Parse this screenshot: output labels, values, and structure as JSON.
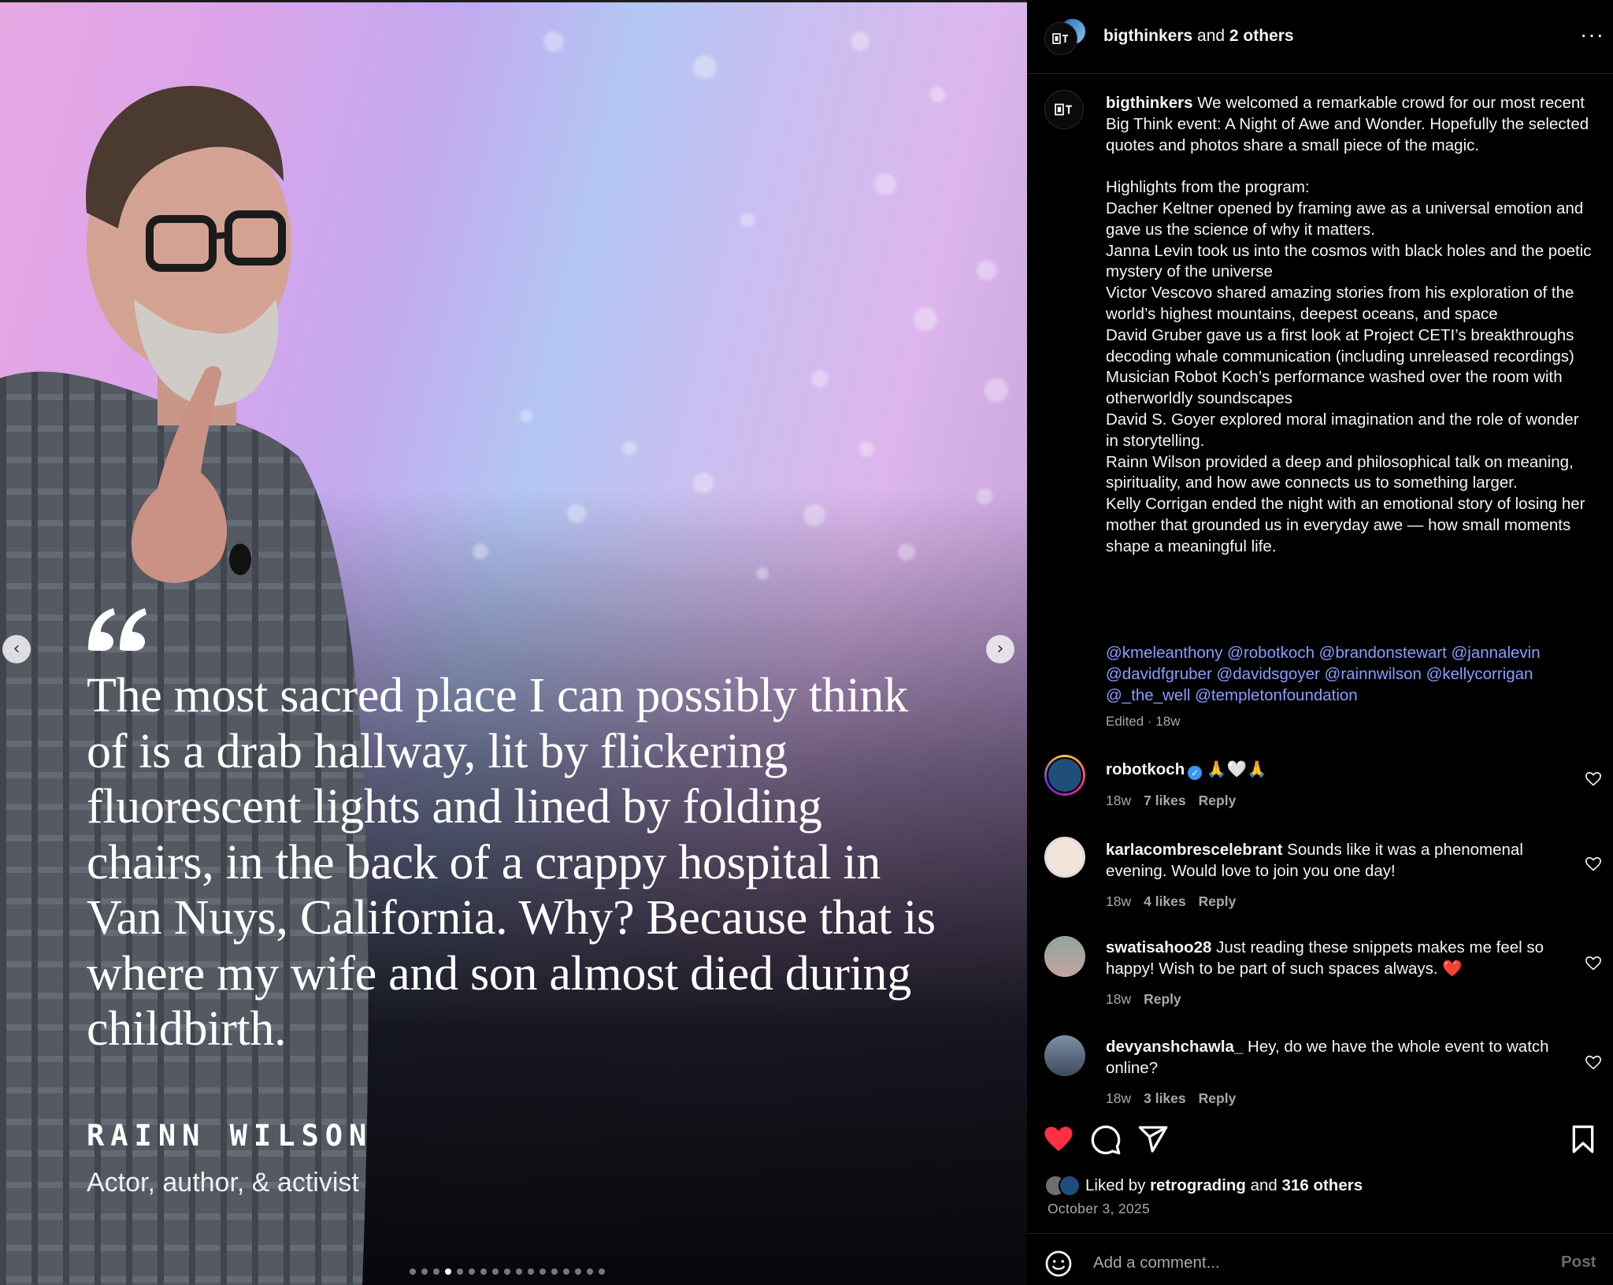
{
  "media": {
    "quote": "The most sacred place I can possibly think of is a drab hallway, lit by flickering fluorescent lights and lined by folding chairs, in the back of a crappy hospital in Van Nuys, California. Why? Because that is where my wife and son almost died during childbirth.",
    "speaker_name": "RAINN WILSON",
    "speaker_title": "Actor, author, & activist",
    "prev_icon": "‹",
    "next_icon": "›",
    "carousel_count": 17,
    "carousel_active_index": 3
  },
  "header": {
    "username": "bigthinkers",
    "and_text": " and ",
    "others": "2 others",
    "more_icon": "···"
  },
  "caption": {
    "username": "bigthinkers",
    "text": " We welcomed a remarkable crowd for our most recent Big Think event: A Night of Awe and Wonder. Hopefully the selected quotes and photos share a small piece of the magic.\n\nHighlights from the program:\nDacher Keltner opened by framing awe as a universal emotion and gave us the science of why it matters.\nJanna Levin took us into the cosmos with black holes and the poetic mystery of the universe\nVictor Vescovo shared amazing stories from his exploration of the world’s highest mountains, deepest oceans, and space\nDavid Gruber gave us a first look at Project CETI’s breakthroughs decoding whale communication (including unreleased recordings)\nMusician Robot Koch’s performance washed over the room with otherworldly soundscapes\nDavid S. Goyer explored moral imagination and the role of wonder in storytelling.\nRainn Wilson provided a deep and philosophical talk on meaning, spirituality, and how awe connects us to something larger.\nKelly Corrigan ended the night with an emotional story of losing her mother that grounded us in everyday awe — how small moments shape a meaningful life.",
    "mentions": "@kmeleanthony @robotkoch @brandonstewart @jannalevin @davidfgruber @davidsgoyer @rainnwilson @kellycorrigan @_the_well @templetonfoundation",
    "edited": "Edited · 18w"
  },
  "comments": [
    {
      "username": "robotkoch",
      "verified": true,
      "text": " 🙏🤍🙏",
      "time": "18w",
      "likes": "7 likes",
      "reply": "Reply"
    },
    {
      "username": "karlacombrescelebrant",
      "verified": false,
      "text": " Sounds like it was a phenomenal evening. Would love to join you one day!",
      "time": "18w",
      "likes": "4 likes",
      "reply": "Reply"
    },
    {
      "username": "swatisahoo28",
      "verified": false,
      "text": " Just reading these snippets makes me feel so happy! Wish to be part of such spaces always. ❤️",
      "time": "18w",
      "likes": "",
      "reply": "Reply"
    },
    {
      "username": "devyanshchawla_",
      "verified": false,
      "text": " Hey, do we have the whole event to watch online?",
      "time": "18w",
      "likes": "3 likes",
      "reply": "Reply"
    }
  ],
  "actions": {
    "liked_prefix": "Liked by ",
    "liked_user": "retrograding",
    "liked_mid": " and ",
    "liked_others": "316 others",
    "date": "October 3, 2025"
  },
  "comment_box": {
    "placeholder": "Add a comment...",
    "post_label": "Post"
  },
  "colors": {
    "like_red": "#ff3040",
    "mention_blue": "#8c9cff",
    "muted": "#a8a8a8"
  }
}
